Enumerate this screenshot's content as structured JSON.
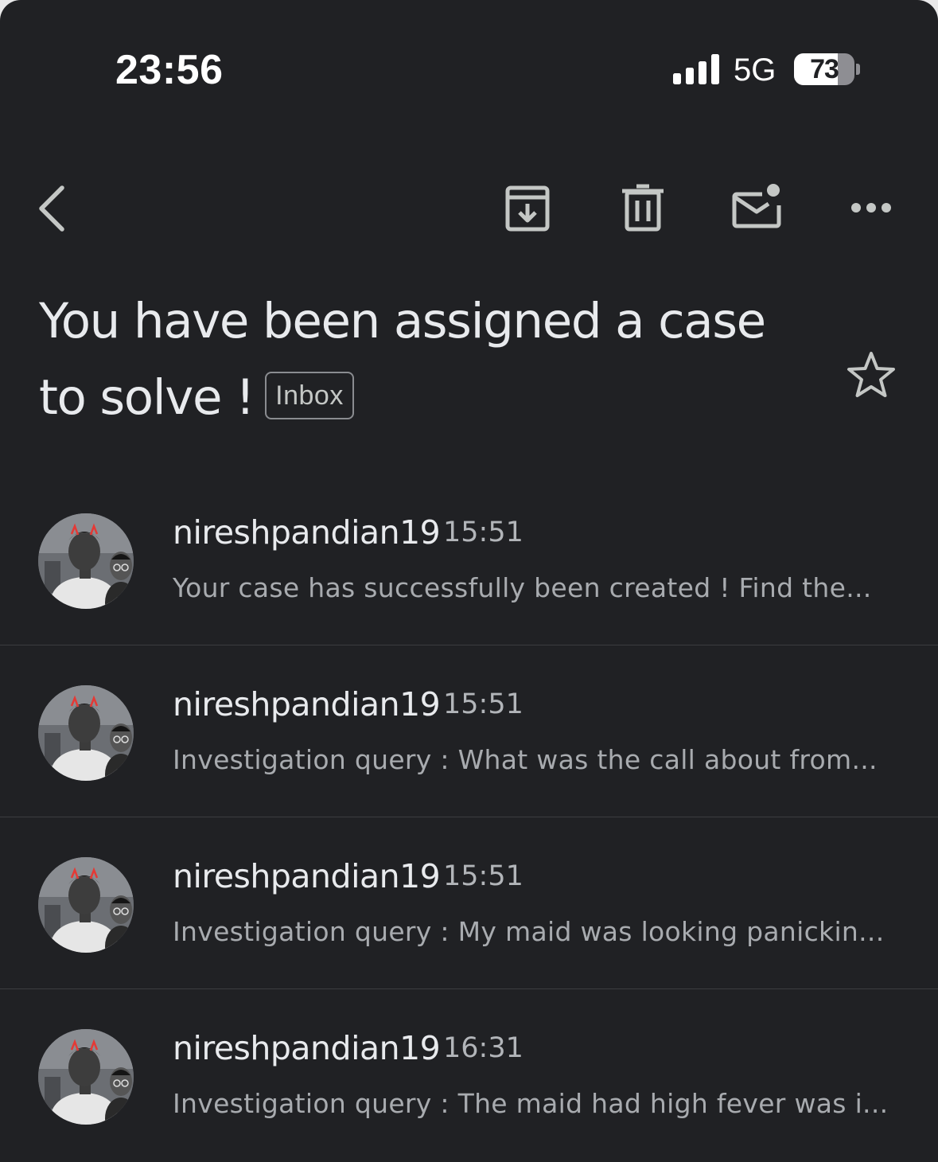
{
  "status_bar": {
    "time": "23:56",
    "network": "5G",
    "battery": "73",
    "battery_level_percent": 73
  },
  "toolbar": {
    "icons": [
      "back-chevron-icon",
      "archive-icon",
      "trash-icon",
      "mark-unread-icon",
      "more-horizontal-icon"
    ]
  },
  "email": {
    "subject": "You have been assigned a case to solve !",
    "label": "Inbox",
    "star_icon": "star-outline-icon"
  },
  "messages": [
    {
      "sender": "nireshpandian19",
      "time": "15:51",
      "snippet": "Your case has successfully been created ! Find the..."
    },
    {
      "sender": "nireshpandian19",
      "time": "15:51",
      "snippet": "Investigation query : What was the call about from..."
    },
    {
      "sender": "nireshpandian19",
      "time": "15:51",
      "snippet": "Investigation query : My maid was looking panickin..."
    },
    {
      "sender": "nireshpandian19",
      "time": "16:31",
      "snippet": "Investigation query : The maid had high fever was i..."
    }
  ],
  "colors": {
    "background": "#202124",
    "text_primary": "#e8eaed",
    "text_secondary": "#a8abaf",
    "divider": "#3c3d40"
  }
}
